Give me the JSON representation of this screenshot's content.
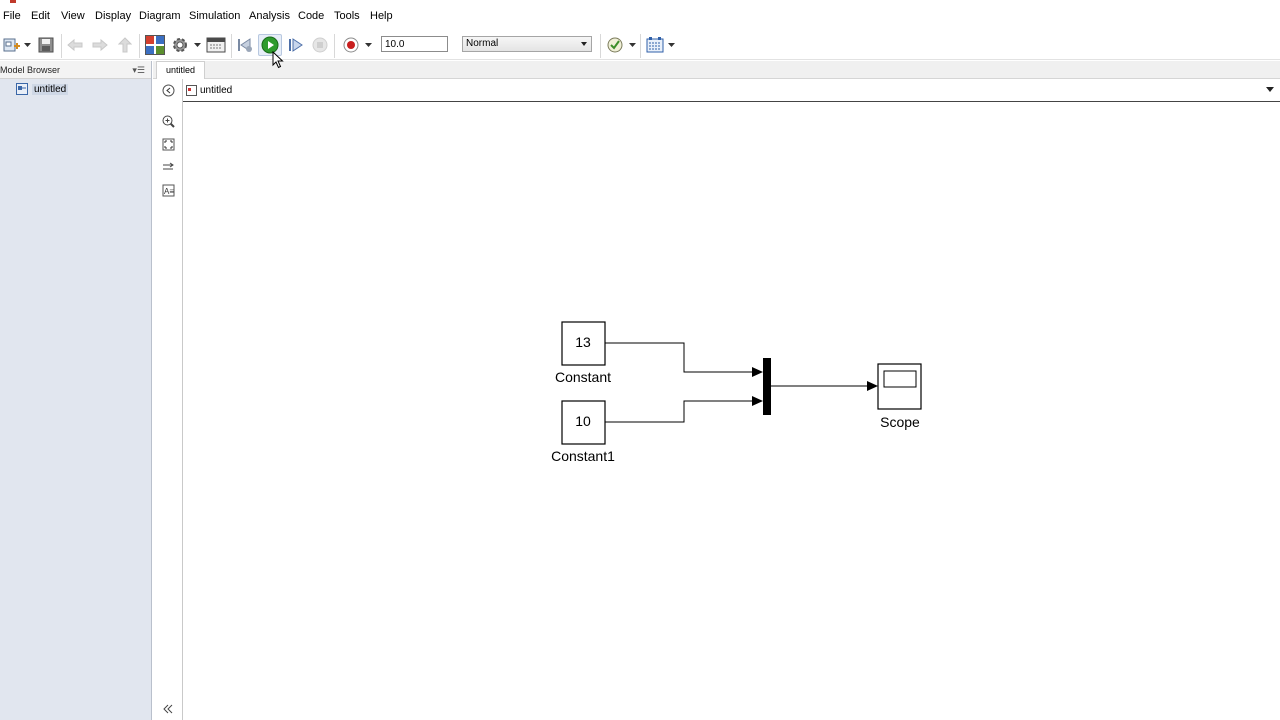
{
  "menu": [
    "File",
    "Edit",
    "View",
    "Display",
    "Diagram",
    "Simulation",
    "Analysis",
    "Code",
    "Tools",
    "Help"
  ],
  "toolbar": {
    "stop_time": "10.0",
    "simulation_mode": "Normal"
  },
  "model_browser": {
    "title": "Model Browser",
    "items": [
      {
        "label": "untitled"
      }
    ]
  },
  "editor": {
    "tab_label": "untitled",
    "address": "untitled"
  },
  "diagram": {
    "blocks": [
      {
        "type": "Constant",
        "value": "13",
        "name": "Constant"
      },
      {
        "type": "Constant",
        "value": "10",
        "name": "Constant1"
      },
      {
        "type": "Mux",
        "inputs": 2
      },
      {
        "type": "Scope",
        "name": "Scope"
      }
    ]
  },
  "colors": {
    "run_button": "#2e9b2e",
    "record_button": "#c81e1e",
    "browser_bg": "#e1e6ef"
  },
  "icons": [
    "new-model-icon",
    "save-icon",
    "back-icon",
    "forward-icon",
    "up-icon",
    "library-browser-icon",
    "model-settings-icon",
    "model-explorer-icon",
    "step-back-icon",
    "run-icon",
    "step-forward-icon",
    "stop-icon",
    "record-icon",
    "model-advisor-icon",
    "build-icon"
  ]
}
